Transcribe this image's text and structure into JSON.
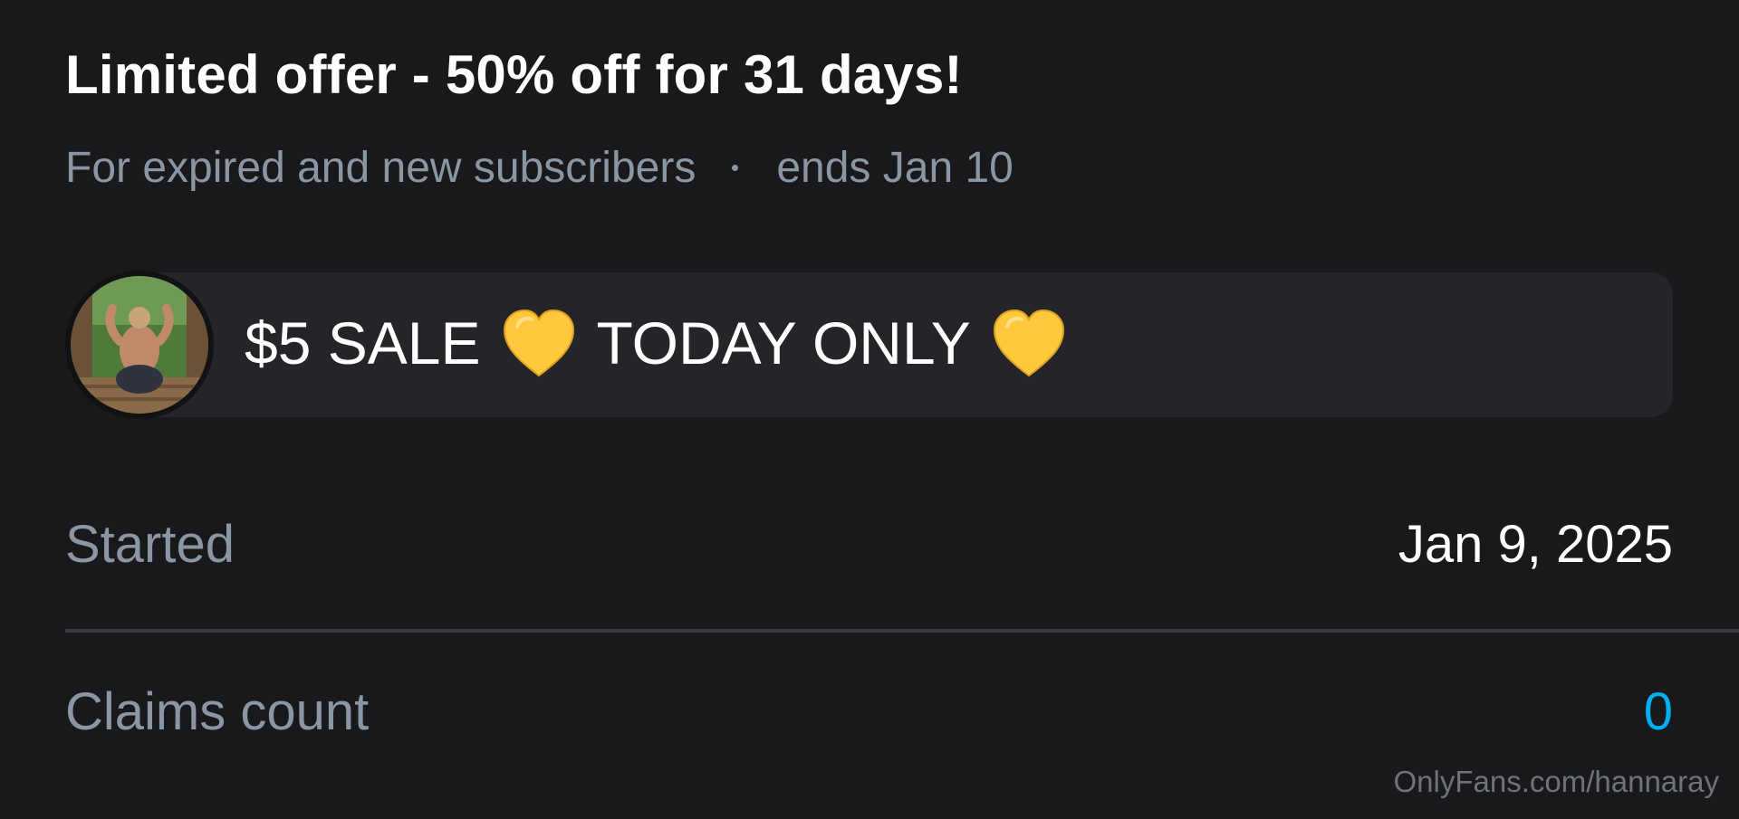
{
  "offer": {
    "title": "Limited offer - 50% off for 31 days!",
    "audience": "For expired and new subscribers",
    "ends": "ends Jan 10"
  },
  "message": {
    "part1": "$5 SALE",
    "part2": "TODAY ONLY",
    "emoji": "yellow-heart-icon"
  },
  "details": {
    "started_label": "Started",
    "started_value": "Jan 9, 2025",
    "claims_label": "Claims count",
    "claims_value": "0"
  },
  "watermark": "OnlyFans.com/hannaray",
  "colors": {
    "background": "#19191b",
    "bubble": "#242528",
    "muted_text": "#8a96a3",
    "accent": "#00aff0",
    "heart": "#ffc83d"
  }
}
